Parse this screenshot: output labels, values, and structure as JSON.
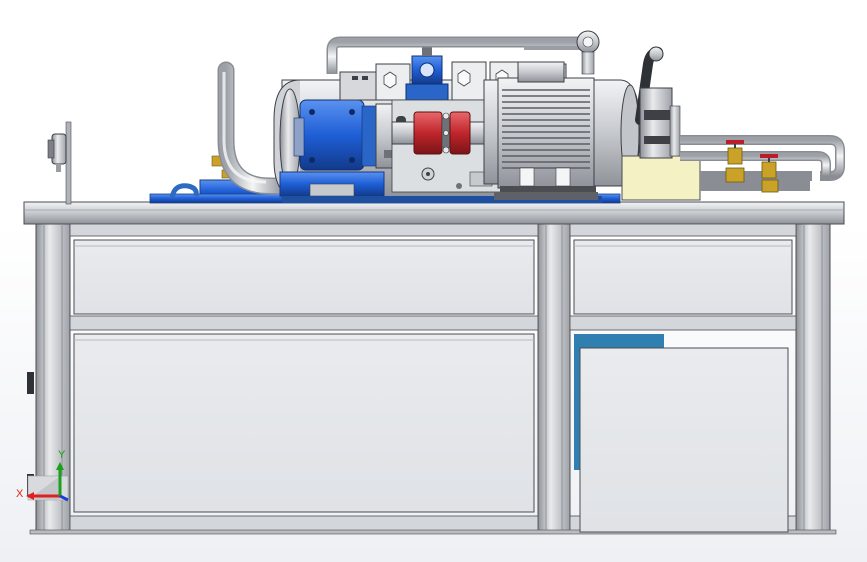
{
  "viewport": {
    "background": "#ffffff",
    "triad": {
      "x_label": "X",
      "y_label": "Y"
    }
  },
  "model": {
    "parts": [
      "frame",
      "table-top",
      "drawer-left",
      "drawer-right",
      "cabinet-door-left",
      "cabinet-door-right",
      "tank",
      "gear-pump",
      "coupling",
      "electric-motor",
      "pressure-gauge",
      "valve-block",
      "pipes",
      "ball-valves",
      "manifold-block"
    ]
  },
  "colors": {
    "frame": "#c9ccd1",
    "frame_edge": "#4a4d52",
    "pump_blue": "#1f5fd6",
    "tank_blue": "#2d6bc2",
    "coupling_red": "#c0262b",
    "motor_grey": "#9a9da3",
    "pale_yellow": "#f4f1c4",
    "valve_red": "#b81f2a",
    "brass": "#c9a227",
    "triad_red": "#e02020",
    "triad_green": "#1aa01a",
    "triad_blue": "#1c3fd0"
  }
}
